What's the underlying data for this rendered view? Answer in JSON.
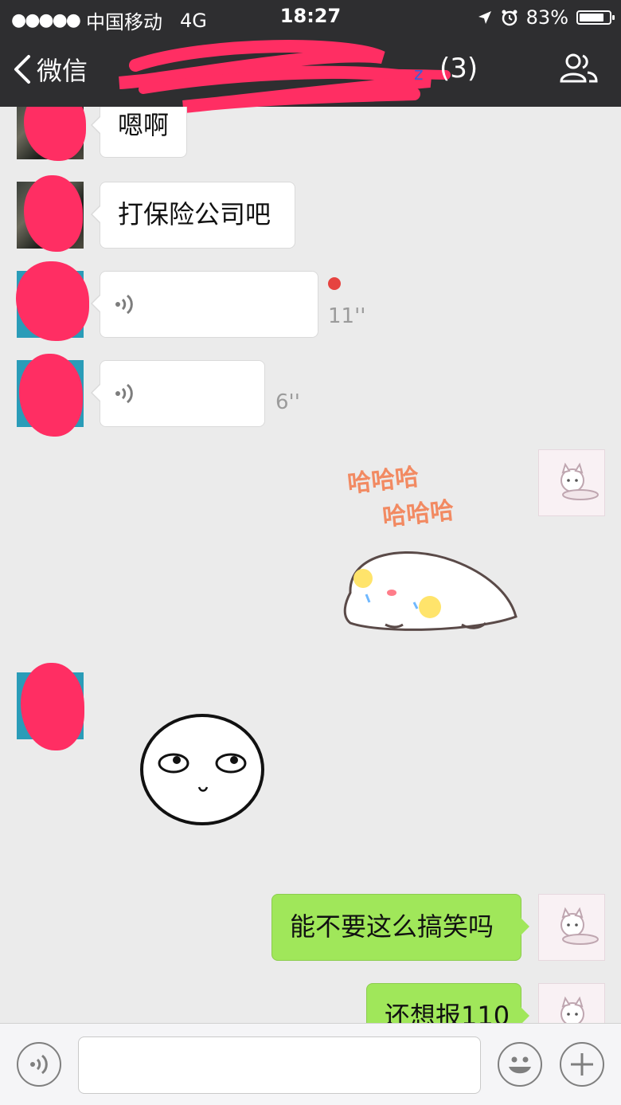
{
  "status_bar": {
    "signal_dots": "●●●●●",
    "carrier": "中国移动",
    "network": "4G",
    "time": "18:27",
    "battery_text": "83%",
    "battery_level": 0.83
  },
  "nav": {
    "back_label": "微信",
    "member_count": "(3)"
  },
  "messages": {
    "m1_text": "嗯啊",
    "m2_text": "打保险公司吧",
    "voice1_duration": "11''",
    "voice2_duration": "6''",
    "sticker_laugh_line1": "哈哈哈",
    "sticker_laugh_line2": "哈哈哈",
    "m_right1_text": "能不要这么搞笑吗",
    "m_right2_text": "还想报110"
  },
  "input": {
    "value": ""
  },
  "colors": {
    "nav_bg": "#2e2e30",
    "chat_bg": "#ebebeb",
    "own_bubble": "#a0e75a",
    "unread": "#e64340",
    "redaction": "#ff2e63"
  }
}
